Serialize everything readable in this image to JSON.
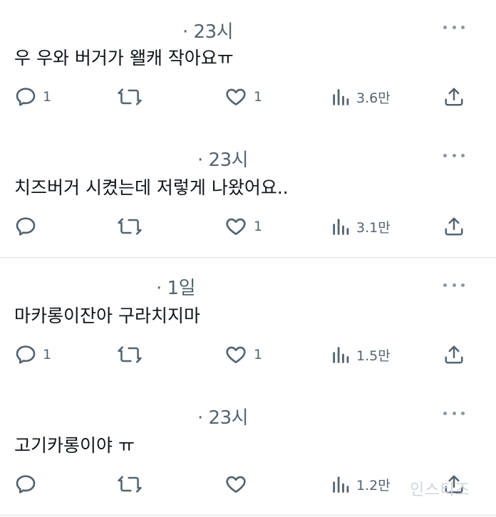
{
  "tweets": [
    {
      "time": "· 23시",
      "text": "우 우와 버거가 왤캐 작아요ㅠ",
      "reply_count": "1",
      "retweet_count": "",
      "like_count": "1",
      "views": "3.6만"
    },
    {
      "time": "· 23시",
      "text": "치즈버거 시켰는데 저렇게 나왔어요..",
      "reply_count": "",
      "retweet_count": "",
      "like_count": "1",
      "views": "3.1만"
    },
    {
      "time": "· 1일",
      "text": "마카롱이잔아 구라치지마",
      "reply_count": "1",
      "retweet_count": "",
      "like_count": "1",
      "views": "1.5만"
    },
    {
      "time": "· 23시",
      "text": "고기카롱이야 ㅠ",
      "reply_count": "",
      "retweet_count": "",
      "like_count": "",
      "views": "1.2만"
    }
  ],
  "watermark": "인스티즈",
  "icons": {
    "reply": "reply-icon",
    "retweet": "retweet-icon",
    "like": "heart-icon",
    "views": "views-icon",
    "share": "share-icon",
    "more": "more-icon"
  },
  "colors": {
    "icon": "#536471",
    "text": "#0f1419",
    "divider": "#dfe3e6"
  }
}
